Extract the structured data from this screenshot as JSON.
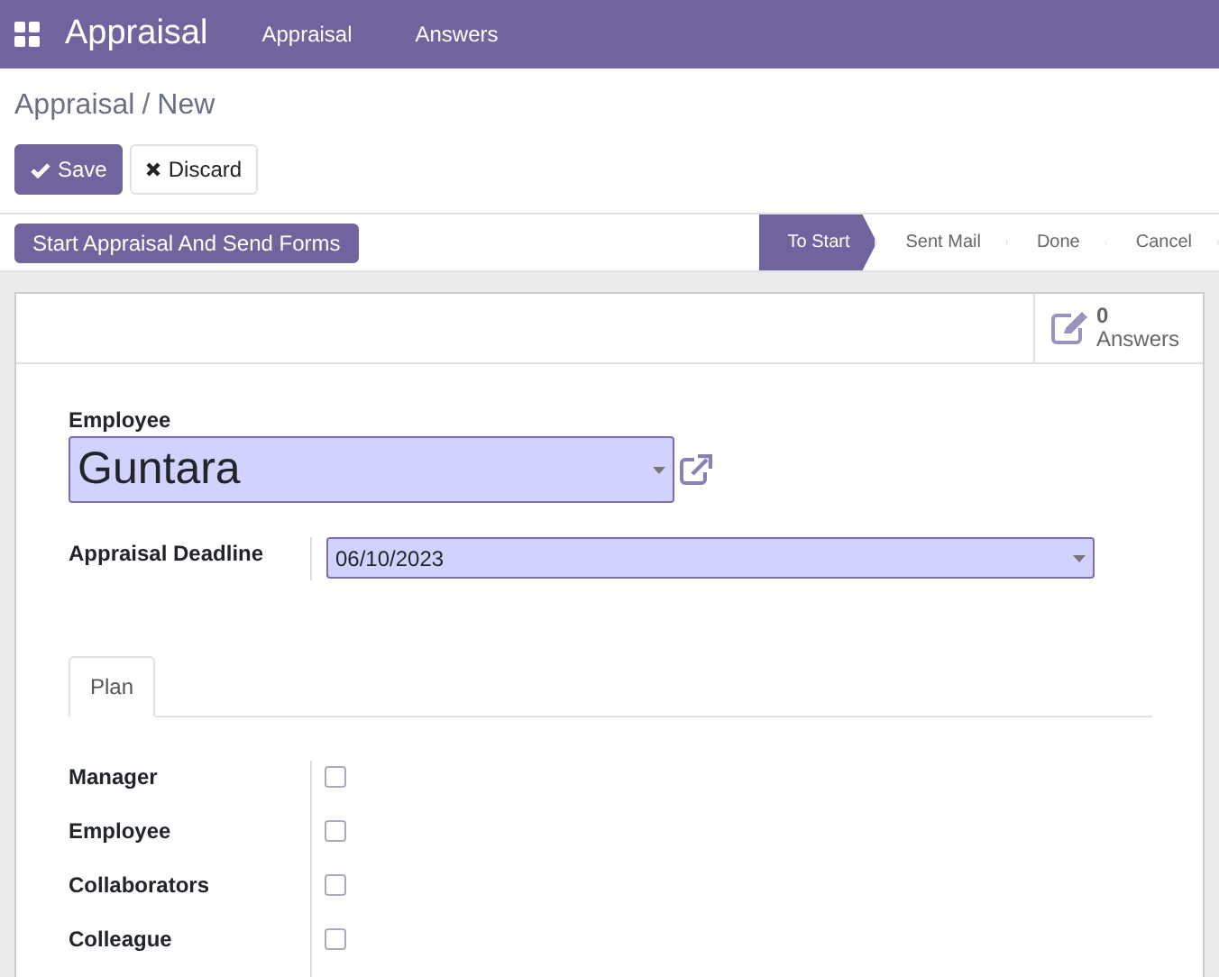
{
  "navbar": {
    "app_title": "Appraisal",
    "menu": [
      {
        "label": "Appraisal"
      },
      {
        "label": "Answers"
      }
    ]
  },
  "breadcrumb": {
    "parent": "Appraisal",
    "separator": "/",
    "current": "New"
  },
  "actions": {
    "save": "Save",
    "discard": "Discard"
  },
  "header": {
    "button": "Start Appraisal And Send Forms",
    "stages": [
      {
        "label": "To Start",
        "selected": true
      },
      {
        "label": "Sent Mail",
        "selected": false
      },
      {
        "label": "Done",
        "selected": false
      },
      {
        "label": "Cancel",
        "selected": false
      }
    ]
  },
  "smart_button": {
    "count": "0",
    "label": "Answers"
  },
  "employee": {
    "label": "Employee",
    "value": "Guntara"
  },
  "deadline": {
    "label": "Appraisal Deadline",
    "value": "06/10/2023"
  },
  "tabs": [
    {
      "label": "Plan",
      "selected": true
    }
  ],
  "plan": [
    {
      "label": "Manager",
      "checked": false
    },
    {
      "label": "Employee",
      "checked": false
    },
    {
      "label": "Collaborators",
      "checked": false
    },
    {
      "label": "Colleague",
      "checked": false
    }
  ]
}
